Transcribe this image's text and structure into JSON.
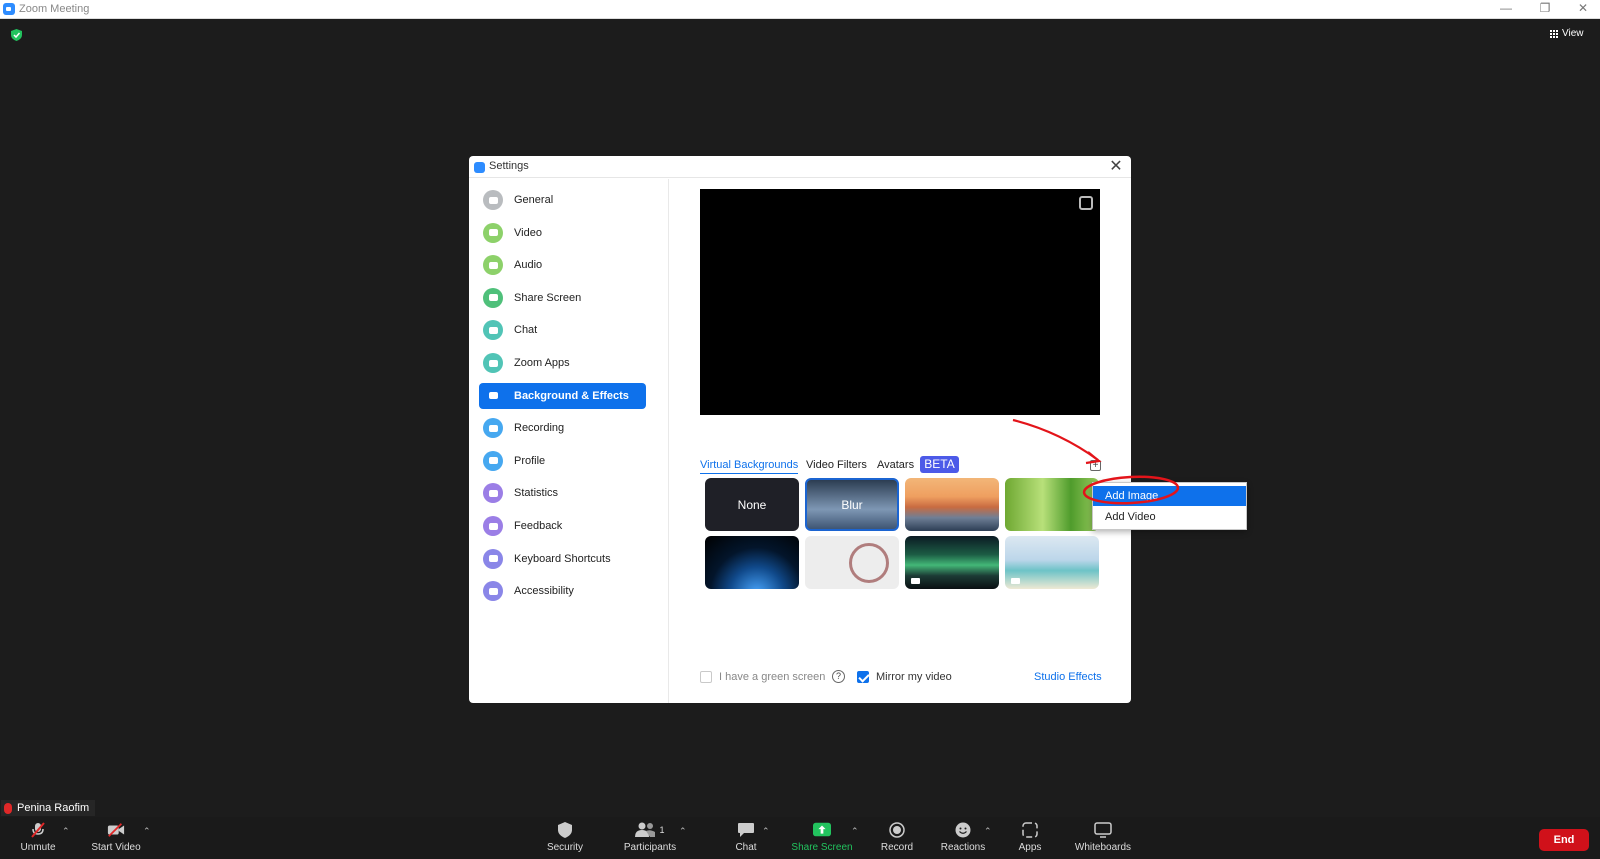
{
  "window": {
    "title": "Zoom Meeting",
    "controls": [
      "—",
      "❐",
      "✕"
    ],
    "view_label": "View"
  },
  "dialog": {
    "title": "Settings",
    "close": "✕"
  },
  "sidebar": {
    "items": [
      {
        "label": "General",
        "icon": "gear-icon",
        "color": "#b9bcbf"
      },
      {
        "label": "Video",
        "icon": "video-camera-icon",
        "color": "#8dd16a"
      },
      {
        "label": "Audio",
        "icon": "headphones-icon",
        "color": "#8dd16a"
      },
      {
        "label": "Share Screen",
        "icon": "share-screen-icon",
        "color": "#4fc07a"
      },
      {
        "label": "Chat",
        "icon": "chat-icon",
        "color": "#51c4b6"
      },
      {
        "label": "Zoom Apps",
        "icon": "zoom-apps-icon",
        "color": "#51c4b6"
      },
      {
        "label": "Background & Effects",
        "icon": "background-icon",
        "color": "#0e71eb",
        "active": true
      },
      {
        "label": "Recording",
        "icon": "recording-icon",
        "color": "#46a8f0"
      },
      {
        "label": "Profile",
        "icon": "profile-icon",
        "color": "#46a8f0"
      },
      {
        "label": "Statistics",
        "icon": "statistics-icon",
        "color": "#9b7ee6"
      },
      {
        "label": "Feedback",
        "icon": "feedback-icon",
        "color": "#9b7ee6"
      },
      {
        "label": "Keyboard Shortcuts",
        "icon": "keyboard-icon",
        "color": "#8a86e8"
      },
      {
        "label": "Accessibility",
        "icon": "accessibility-icon",
        "color": "#8a86e8"
      }
    ]
  },
  "tabs": {
    "virtual": "Virtual Backgrounds",
    "filters": "Video Filters",
    "avatars": "Avatars",
    "beta": "BETA"
  },
  "add_button": "+",
  "backgrounds": {
    "none": "None",
    "blur": "Blur"
  },
  "add_menu": {
    "image": "Add Image",
    "video": "Add Video"
  },
  "options": {
    "green_screen": "I have a green screen",
    "help": "?",
    "mirror": "Mirror my video",
    "studio": "Studio Effects"
  },
  "participant": {
    "name": "Penina Raofim"
  },
  "toolbar": {
    "unmute": "Unmute",
    "start_video": "Start Video",
    "security": "Security",
    "participants": "Participants",
    "participants_count": "1",
    "chat": "Chat",
    "share": "Share Screen",
    "record": "Record",
    "reactions": "Reactions",
    "apps": "Apps",
    "whiteboards": "Whiteboards",
    "end": "End"
  },
  "colors": {
    "accent": "#0e71eb",
    "share_green": "#22c35e",
    "end_red": "#d0111a",
    "annotation_red": "#e3141a"
  }
}
